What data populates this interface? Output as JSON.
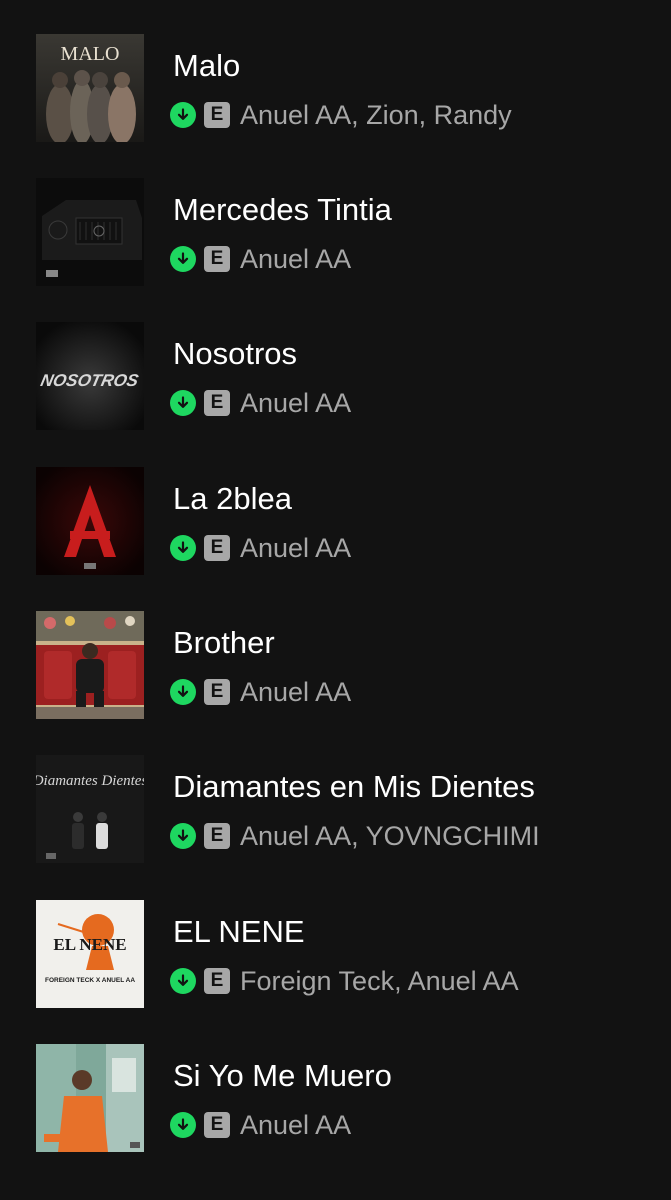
{
  "colors": {
    "background": "#121212",
    "title": "#ffffff",
    "subtitle": "#a7a7a7",
    "download_indicator": "#1ed760",
    "explicit_badge": "#a7a7a7"
  },
  "icons": {
    "download": "download-arrow-icon",
    "explicit": "explicit-badge"
  },
  "tracks": [
    {
      "title": "Malo",
      "artists": "Anuel AA, Zion, Randy",
      "explicit_label": "E",
      "downloaded": true,
      "cover_text": "MALO"
    },
    {
      "title": "Mercedes Tintia",
      "artists": "Anuel AA",
      "explicit_label": "E",
      "downloaded": true
    },
    {
      "title": "Nosotros",
      "artists": "Anuel AA",
      "explicit_label": "E",
      "downloaded": true,
      "cover_text": "NOSOTROS"
    },
    {
      "title": "La 2blea",
      "artists": "Anuel AA",
      "explicit_label": "E",
      "downloaded": true
    },
    {
      "title": "Brother",
      "artists": "Anuel AA",
      "explicit_label": "E",
      "downloaded": true
    },
    {
      "title": "Diamantes en Mis Dientes",
      "artists": "Anuel AA, YOVNGCHIMI",
      "explicit_label": "E",
      "downloaded": true,
      "cover_text": "Diamantes Dientes"
    },
    {
      "title": "EL NENE",
      "artists": "Foreign Teck, Anuel AA",
      "explicit_label": "E",
      "downloaded": true,
      "cover_text": "EL NENE",
      "cover_subtext": "FOREIGN TECK X ANUEL AA"
    },
    {
      "title": "Si Yo Me Muero",
      "artists": "Anuel AA",
      "explicit_label": "E",
      "downloaded": true
    }
  ]
}
